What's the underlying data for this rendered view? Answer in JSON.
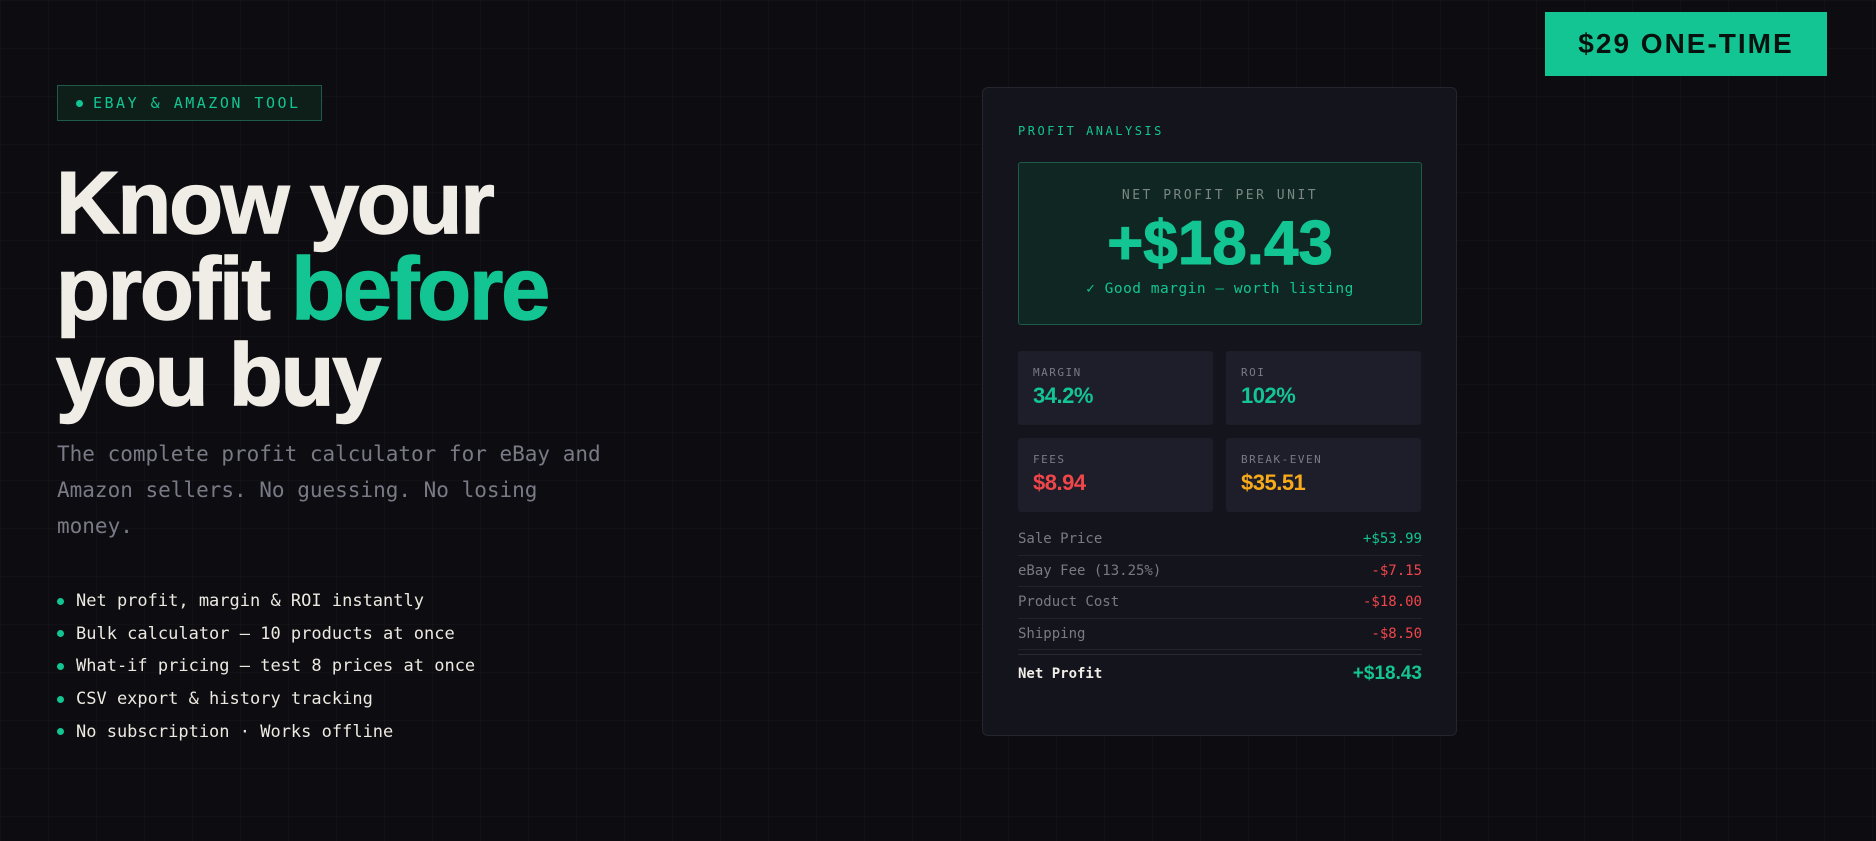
{
  "cta": {
    "label": "$29 ONE-TIME"
  },
  "hero": {
    "badge": "EBAY & AMAZON TOOL",
    "headline": {
      "line1": "Know your",
      "line2_prefix": "profit ",
      "line2_accent": "before",
      "line3": "you buy"
    },
    "subtitle": "The complete profit calculator for eBay and Amazon sellers. No guessing. No losing money.",
    "features": [
      "Net profit, margin & ROI instantly",
      "Bulk calculator — 10 products at once",
      "What-if pricing — test 8 prices at once",
      "CSV export & history tracking",
      "No subscription · Works offline"
    ]
  },
  "card": {
    "title": "PROFIT ANALYSIS",
    "net_profit_label": "NET PROFIT PER UNIT",
    "net_profit_value": "+$18.43",
    "net_profit_note": "✓ Good margin — worth listing",
    "stats": {
      "margin": {
        "label": "MARGIN",
        "value": "34.2%"
      },
      "roi": {
        "label": "ROI",
        "value": "102%"
      },
      "fees": {
        "label": "FEES",
        "value": "$8.94"
      },
      "break_even": {
        "label": "BREAK-EVEN",
        "value": "$35.51"
      }
    },
    "breakdown": [
      {
        "label": "Sale Price",
        "value": "+$53.99"
      },
      {
        "label": "eBay Fee (13.25%)",
        "value": "-$7.15"
      },
      {
        "label": "Product Cost",
        "value": "-$18.00"
      },
      {
        "label": "Shipping",
        "value": "-$8.50"
      }
    ],
    "net_profit_row": {
      "label": "Net Profit",
      "value": "+$18.43"
    }
  },
  "colors": {
    "accent": "#12c592",
    "negative": "#f0464a",
    "warning": "#f8aa19",
    "background": "#0c0c11"
  }
}
